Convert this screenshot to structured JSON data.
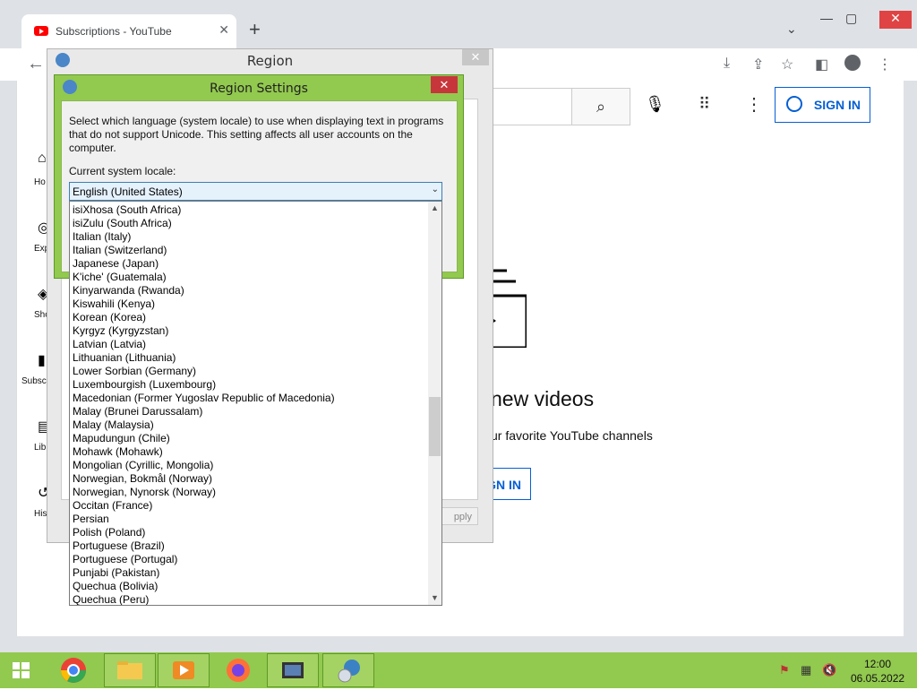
{
  "browser": {
    "tab_title": "Subscriptions - YouTube",
    "new_tab": "+",
    "close_tab": "✕",
    "tab_search": "⌄",
    "minimize": "—",
    "maximize": "▢",
    "close": "✕",
    "back": "←"
  },
  "youtube": {
    "sign_in": "SIGN IN",
    "heading_partial": "new videos",
    "subtext_partial": "ur favorite YouTube channels",
    "sign_in_partial": "GN IN",
    "sidebar": [
      "Ho",
      "Exp",
      "Sho",
      "Subscr",
      "Libr",
      "His"
    ]
  },
  "region": {
    "title": "Region",
    "close": "✕",
    "apply_partial": "pply"
  },
  "region_settings": {
    "title": "Region Settings",
    "close": "✕",
    "description": "Select which language (system locale) to use when displaying text in programs that do not support Unicode. This setting affects all user accounts on the computer.",
    "label": "Current system locale:",
    "selected": "English (United States)",
    "options": [
      "isiXhosa (South Africa)",
      "isiZulu (South Africa)",
      "Italian (Italy)",
      "Italian (Switzerland)",
      "Japanese (Japan)",
      "K'iche' (Guatemala)",
      "Kinyarwanda (Rwanda)",
      "Kiswahili (Kenya)",
      "Korean (Korea)",
      "Kyrgyz (Kyrgyzstan)",
      "Latvian (Latvia)",
      "Lithuanian (Lithuania)",
      "Lower Sorbian (Germany)",
      "Luxembourgish (Luxembourg)",
      "Macedonian (Former Yugoslav Republic of Macedonia)",
      "Malay (Brunei Darussalam)",
      "Malay (Malaysia)",
      "Mapudungun (Chile)",
      "Mohawk (Mohawk)",
      "Mongolian (Cyrillic, Mongolia)",
      "Norwegian, Bokmål (Norway)",
      "Norwegian, Nynorsk (Norway)",
      "Occitan (France)",
      "Persian",
      "Polish (Poland)",
      "Portuguese (Brazil)",
      "Portuguese (Portugal)",
      "Punjabi (Pakistan)",
      "Quechua (Bolivia)",
      "Quechua (Peru)"
    ]
  },
  "taskbar": {
    "time": "12:00",
    "date": "06.05.2022",
    "apps": [
      "start-icon",
      "chrome-icon",
      "explorer-icon",
      "media-player-icon",
      "firefox-icon",
      "movie-maker-icon",
      "region-globe-icon"
    ]
  },
  "colors": {
    "accent_green": "#92c94f",
    "close_red": "#c7363b",
    "youtube_blue": "#065fd4"
  }
}
